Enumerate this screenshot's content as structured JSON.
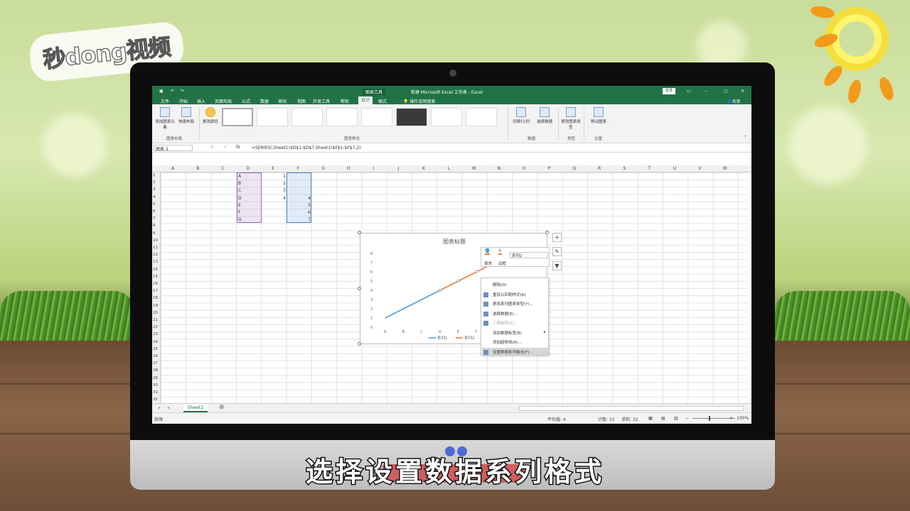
{
  "brand": {
    "logo_text": "秒dong视频"
  },
  "excel": {
    "title": "新建 Microsoft Excel 工作表 - Excel",
    "chart_tools": "图表工具",
    "login": "登录",
    "share": "共享",
    "tabs": [
      "文件",
      "开始",
      "插入",
      "页面布局",
      "公式",
      "数据",
      "审阅",
      "视图",
      "开发工具",
      "帮助",
      "设计",
      "格式"
    ],
    "active_tab": "设计",
    "search": "操作说明搜索",
    "ribbon": {
      "add_element": "添加图表元素",
      "quick_layout": "快速布局",
      "change_color": "更改颜色",
      "switch_row_col": "切换行/列",
      "select_data": "选择数据",
      "change_type": "更改图表类型",
      "move_chart": "移动图表",
      "groups": {
        "layout": "图表布局",
        "styles": "图表样式",
        "data": "数据",
        "type": "类型",
        "location": "位置"
      }
    },
    "namebox": "图表 2",
    "formula": "=SERIES(,Sheet1!$D$1:$D$7,Sheet1!$F$1:$F$7,2)",
    "columns": [
      "A",
      "B",
      "C",
      "D",
      "E",
      "F",
      "G",
      "H",
      "I",
      "J",
      "K",
      "L",
      "M",
      "N",
      "O",
      "P",
      "Q",
      "R",
      "S",
      "T",
      "U",
      "V",
      "W"
    ],
    "rows": [
      "1",
      "2",
      "3",
      "4",
      "5",
      "6",
      "7",
      "8",
      "9",
      "10",
      "11",
      "12",
      "13",
      "14",
      "15",
      "16",
      "17",
      "18",
      "19",
      "20",
      "21",
      "22",
      "23",
      "24",
      "25",
      "26",
      "27",
      "28",
      "29",
      "30",
      "31",
      "32"
    ],
    "colD": [
      "A",
      "B",
      "C",
      "D",
      "E",
      "F",
      "G"
    ],
    "colE": [
      "1",
      "2",
      "3",
      "4",
      "",
      "",
      ""
    ],
    "colF": [
      "",
      "",
      "",
      "4",
      "5",
      "6",
      "7"
    ],
    "sheet": "Sheet1",
    "status": {
      "ready": "就绪",
      "average": "平均值: 4",
      "count": "计数: 15",
      "sum": "求和: 32",
      "zoom": "100%"
    }
  },
  "chart": {
    "title": "图表标题",
    "yticks": [
      "0",
      "1",
      "2",
      "3",
      "4",
      "5",
      "6",
      "7",
      "8"
    ],
    "xticks": [
      "A",
      "B",
      "C",
      "D",
      "E",
      "F",
      "G"
    ],
    "legend": [
      "系列1",
      "系列2"
    ]
  },
  "chart_data": {
    "type": "line",
    "title": "图表标题",
    "categories": [
      "A",
      "B",
      "C",
      "D",
      "E",
      "F",
      "G"
    ],
    "series": [
      {
        "name": "系列1",
        "values": [
          1,
          2,
          3,
          4,
          null,
          null,
          null
        ],
        "color": "#5b9bd5"
      },
      {
        "name": "系列2",
        "values": [
          null,
          null,
          null,
          4,
          5,
          6,
          7
        ],
        "color": "#ed7d31"
      }
    ],
    "ylim": [
      0,
      8
    ]
  },
  "mini_toolbar": {
    "fill": "填充",
    "border": "边框",
    "series": "系列2"
  },
  "context_menu": {
    "items": [
      "删除(D)",
      "重设以匹配样式(A)",
      "更改系列图表类型(Y)...",
      "选择数据(E)...",
      "三维旋转(R)...",
      "添加数据标签(B)",
      "添加趋势线(R)...",
      "设置数据系列格式(F)..."
    ]
  },
  "caption": "选择设置数据系列格式",
  "colors": {
    "excel_green": "#217346",
    "sun": "#f4de3c",
    "ray": "#f39a1b"
  }
}
